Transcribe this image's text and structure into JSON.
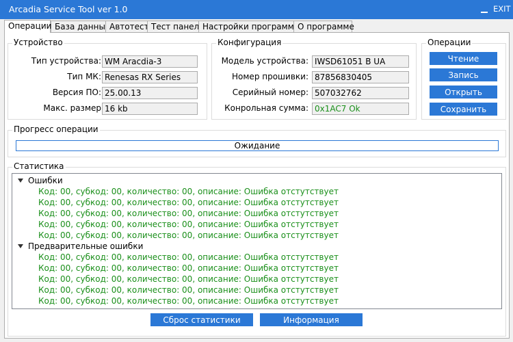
{
  "window": {
    "title": "Arcadia Service Tool ver 1.0",
    "exit_label": "EXIT"
  },
  "tabs": [
    "Операции",
    "База данных",
    "Автотест",
    "Тест панель",
    "Настройки программы",
    "О программе"
  ],
  "device": {
    "legend": "Устройство",
    "rows": [
      {
        "label": "Тип устройства:",
        "value": "WM Aracdia-3"
      },
      {
        "label": "Тип МК:",
        "value": "Renesas RX Series"
      },
      {
        "label": "Версия ПО:",
        "value": "25.00.13"
      },
      {
        "label": "Макс. размер",
        "value": "16 kb"
      }
    ]
  },
  "config": {
    "legend": "Конфигурация",
    "rows": [
      {
        "label": "Модель устройства:",
        "value": "IWSD61051 B UA"
      },
      {
        "label": "Номер прошивки:",
        "value": "87856830405"
      },
      {
        "label": "Серийный номер:",
        "value": "507032762"
      },
      {
        "label": "Конрольная сумма:",
        "value": "0x1AC7   Ok"
      }
    ]
  },
  "operations": {
    "legend": "Операции",
    "buttons": [
      "Чтение",
      "Запись",
      "Открыть",
      "Сохранить"
    ]
  },
  "progress": {
    "legend": "Прогресс операции",
    "text": "Ожидание"
  },
  "stats": {
    "legend": "Статистика",
    "groups": [
      {
        "title": "Ошибки",
        "items": [
          "Код: 00, субкод: 00, количество: 00, описание: Ошибка отстутствует",
          "Код: 00, субкод: 00, количество: 00, описание: Ошибка отстутствует",
          "Код: 00, субкод: 00, количество: 00, описание: Ошибка отстутствует",
          "Код: 00, субкод: 00, количество: 00, описание: Ошибка отстутствует",
          "Код: 00, субкод: 00, количество: 00, описание: Ошибка отстутствует"
        ]
      },
      {
        "title": "Предварительные ошибки",
        "items": [
          "Код: 00, субкод: 00, количество: 00, описание: Ошибка отстутствует",
          "Код: 00, субкод: 00, количество: 00, описание: Ошибка отстутствует",
          "Код: 00, субкод: 00, количество: 00, описание: Ошибка отстутствует",
          "Код: 00, субкод: 00, количество: 00, описание: Ошибка отстутствует",
          "Код: 00, субкод: 00, количество: 00, описание: Ошибка отстутствует"
        ]
      }
    ],
    "reset_label": "Сброс статистики",
    "info_label": "Информация"
  },
  "colors": {
    "accent": "#2b78d6",
    "ok": "#1a8f1a"
  }
}
